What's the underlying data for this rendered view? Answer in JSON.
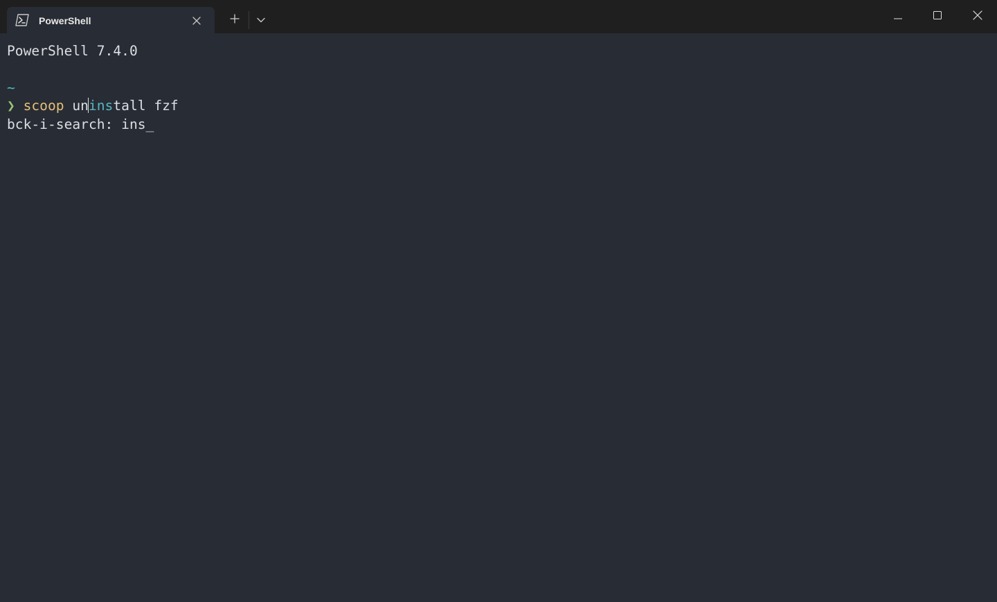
{
  "window": {
    "tab_title": "PowerShell",
    "tab_icon": "powershell-icon",
    "new_tab_icon": "plus-icon",
    "dropdown_icon": "chevron-down-icon",
    "controls": [
      "minimize-icon",
      "maximize-icon",
      "close-icon"
    ]
  },
  "terminal": {
    "version_line": "PowerShell 7.4.0",
    "prompt_path": "~",
    "prompt_char": "❯",
    "command": "scoop",
    "arg_before_match": "un",
    "arg_match": "ins",
    "arg_after_match": "tall",
    "rest": " fzf",
    "search_line": "bck-i-search: ins_"
  },
  "colors": {
    "background": "#282c34",
    "titlebar": "#1f1f1f",
    "text": "#dcdfe4",
    "command": "#e5c07b",
    "path": "#56b6c2",
    "prompt": "#98c379"
  }
}
